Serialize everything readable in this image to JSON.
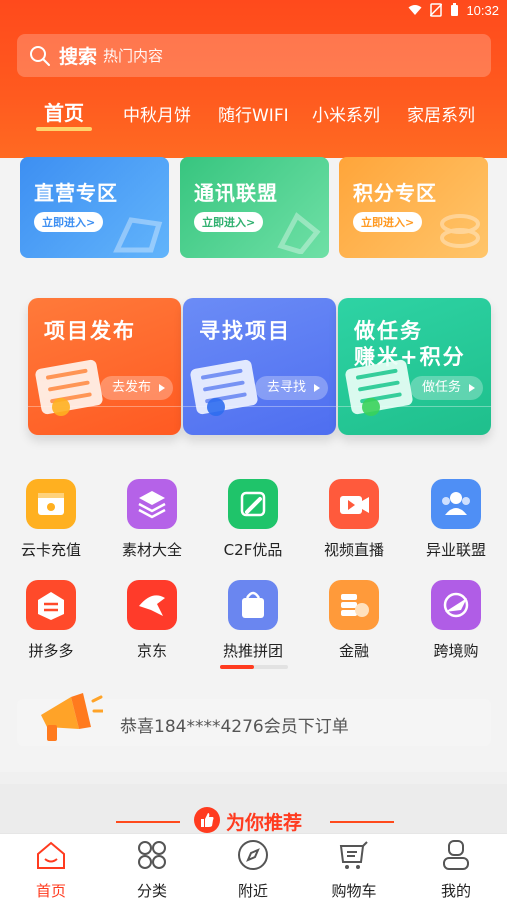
{
  "status_bar": {
    "time": "10:32"
  },
  "search": {
    "label": "搜索",
    "placeholder": "热门内容"
  },
  "tabs": [
    {
      "label": "首页",
      "active": true
    },
    {
      "label": "中秋月饼"
    },
    {
      "label": "随行WIFI"
    },
    {
      "label": "小米系列"
    },
    {
      "label": "家居系列"
    }
  ],
  "zones": [
    {
      "title": "直营专区",
      "button": "立即进入>",
      "color": "#3f9bf4"
    },
    {
      "title": "通讯联盟",
      "button": "立即进入>",
      "color": "#3fcf8b"
    },
    {
      "title": "积分专区",
      "button": "立即进入>",
      "color": "#ffb347"
    }
  ],
  "big_cards": [
    {
      "title_line1": "项目发布",
      "title_line2": "",
      "button": "去发布",
      "color": "#ff6a2a"
    },
    {
      "title_line1": "寻找项目",
      "title_line2": "",
      "button": "去寻找",
      "color": "#5b7cf2"
    },
    {
      "title_line1": "做任务",
      "title_line2": "赚米+积分",
      "button": "做任务",
      "color": "#27c99a"
    }
  ],
  "grid": [
    {
      "label": "云卡充值",
      "icon": "card-icon",
      "color": "#ffb020"
    },
    {
      "label": "素材大全",
      "icon": "layers-icon",
      "color": "#b562e8"
    },
    {
      "label": "C2F优品",
      "icon": "pencil-icon",
      "color": "#1fc46a"
    },
    {
      "label": "视频直播",
      "icon": "video-icon",
      "color": "#ff5a3c"
    },
    {
      "label": "异业联盟",
      "icon": "people-icon",
      "color": "#4f8ff5"
    },
    {
      "label": "拼多多",
      "icon": "pinduoduo-icon",
      "color": "#ff4a2a"
    },
    {
      "label": "京东",
      "icon": "jd-icon",
      "color": "#ff3b2a"
    },
    {
      "label": "热推拼团",
      "icon": "bag-icon",
      "color": "#6a86f0"
    },
    {
      "label": "金融",
      "icon": "finance-icon",
      "color": "#ff9a3a"
    },
    {
      "label": "跨境购",
      "icon": "plane-icon",
      "color": "#b05de6"
    }
  ],
  "notice": {
    "text": "恭喜184****4276会员下订单"
  },
  "recommend": {
    "title": "为你推荐"
  },
  "bottom_nav": [
    {
      "label": "首页",
      "icon": "home-icon",
      "active": true
    },
    {
      "label": "分类",
      "icon": "category-icon"
    },
    {
      "label": "附近",
      "icon": "compass-icon"
    },
    {
      "label": "购物车",
      "icon": "cart-icon"
    },
    {
      "label": "我的",
      "icon": "profile-icon"
    }
  ],
  "colors": {
    "primary": "#ff4a1c",
    "accent": "#ff3b1f"
  }
}
